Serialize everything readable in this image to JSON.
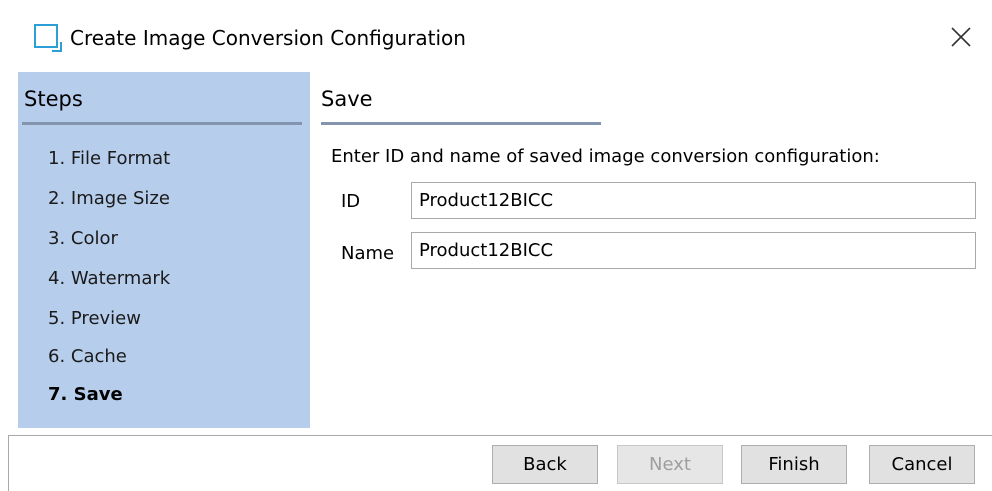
{
  "window": {
    "title": "Create Image Conversion Configuration",
    "icon": "window-icon",
    "close_icon": "close-icon"
  },
  "steps": {
    "heading": "Steps",
    "items": [
      {
        "label": "1. File Format",
        "active": false
      },
      {
        "label": "2. Image Size",
        "active": false
      },
      {
        "label": "3. Color",
        "active": false
      },
      {
        "label": "4. Watermark",
        "active": false
      },
      {
        "label": "5. Preview",
        "active": false
      },
      {
        "label": "6. Cache",
        "active": false
      },
      {
        "label": "7. Save",
        "active": true
      }
    ]
  },
  "content": {
    "heading": "Save",
    "instruction": "Enter ID and name of saved image conversion configuration:",
    "fields": [
      {
        "label": "ID",
        "value": "Product12BICC"
      },
      {
        "label": "Name",
        "value": "Product12BICC"
      }
    ]
  },
  "footer": {
    "back_label": "Back",
    "next_label": "Next",
    "next_enabled": false,
    "finish_label": "Finish",
    "cancel_label": "Cancel"
  },
  "colors": {
    "steps_panel_bg": "#b6cdeb",
    "rule": "#8294ae",
    "icon_accent": "#2e9fd6"
  }
}
